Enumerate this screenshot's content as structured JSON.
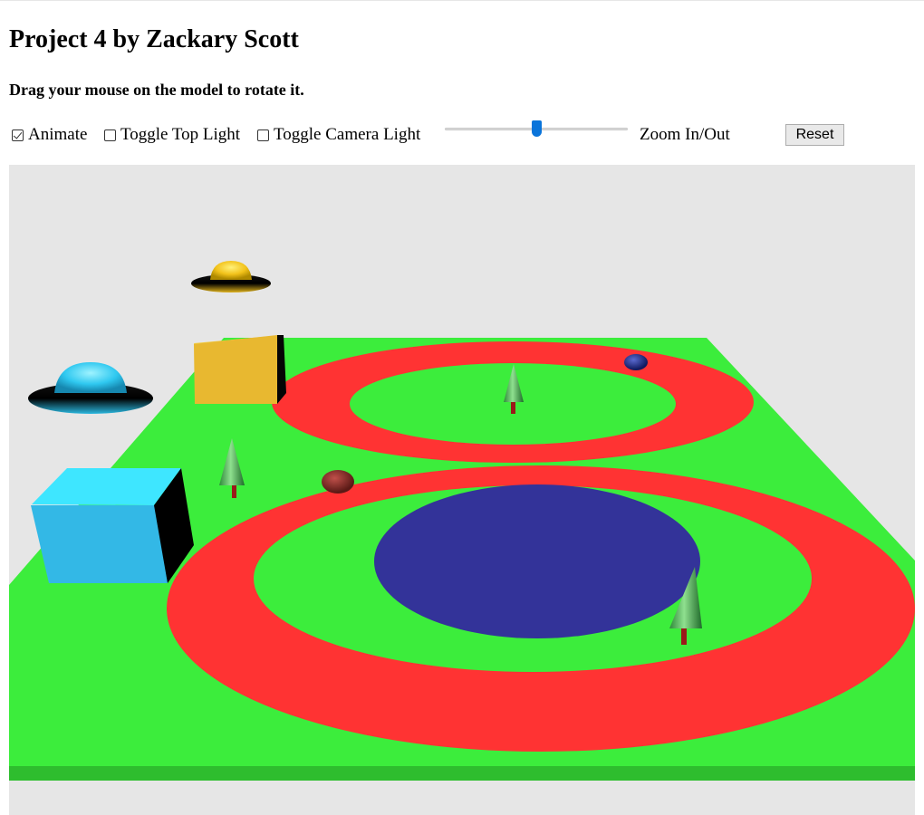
{
  "page": {
    "title": "Project 4 by Zackary Scott",
    "instructions": "Drag your mouse on the model to rotate it."
  },
  "controls": {
    "animate": {
      "label": "Animate",
      "checked": true
    },
    "top_light": {
      "label": "Toggle Top Light",
      "checked": false
    },
    "camera_light": {
      "label": "Toggle Camera Light",
      "checked": false
    },
    "zoom": {
      "label": "Zoom In/Out",
      "value_fraction": 0.5
    },
    "reset_label": "Reset"
  },
  "scene": {
    "background_color": "#e6e6e6",
    "ground_color": "#3ced3c",
    "ground_edge_color": "#2ebd2e",
    "track_color": "#ff3333",
    "pond_color": "#333399",
    "objects": [
      "yellow-cube",
      "cyan-cube",
      "yellow-ufo",
      "cyan-ufo",
      "tree",
      "tree",
      "tree",
      "red-ball",
      "blue-ball",
      "pond"
    ]
  }
}
